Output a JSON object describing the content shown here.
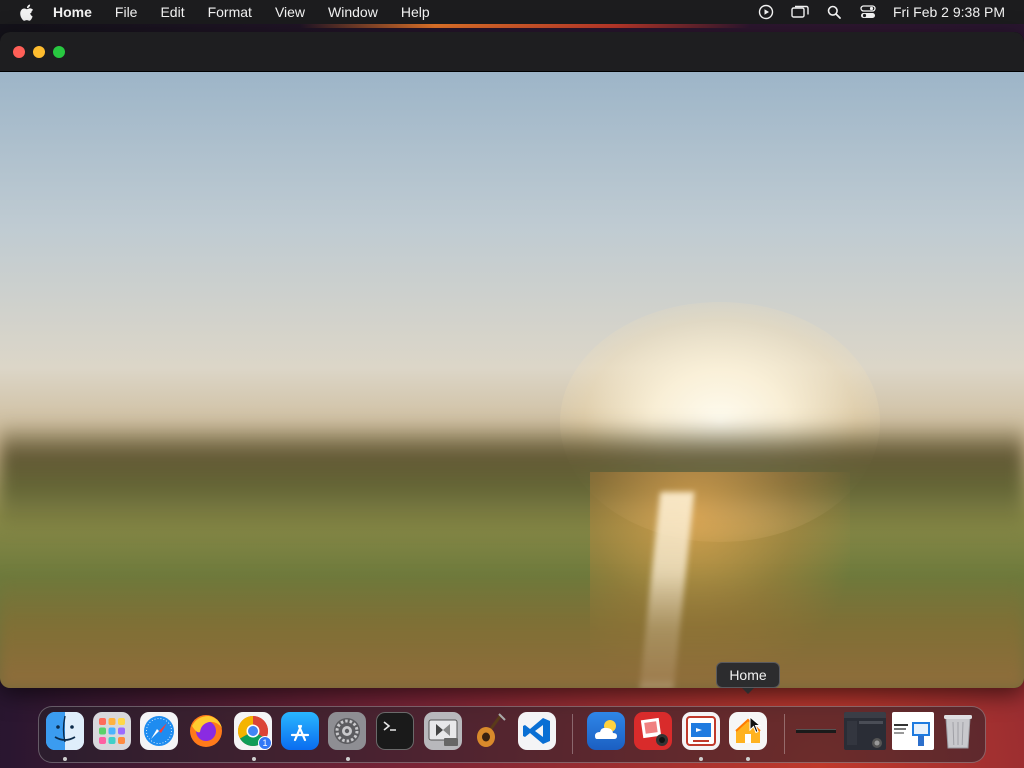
{
  "menubar": {
    "app_name": "Home",
    "items": [
      "File",
      "Edit",
      "Format",
      "View",
      "Window",
      "Help"
    ],
    "clock": "Fri Feb 2  9:38 PM",
    "status_icons": [
      "play-circle-icon",
      "screen-mirroring-icon",
      "spotlight-search-icon",
      "control-center-icon"
    ]
  },
  "window": {
    "traffic_lights": [
      "close",
      "minimize",
      "zoom"
    ]
  },
  "dock": {
    "tooltip": "Home",
    "apps": [
      {
        "name": "Finder",
        "icon": "finder-icon",
        "running": true
      },
      {
        "name": "Launchpad",
        "icon": "launchpad-icon",
        "running": false
      },
      {
        "name": "Safari",
        "icon": "safari-icon",
        "running": false
      },
      {
        "name": "Firefox",
        "icon": "firefox-icon",
        "running": false
      },
      {
        "name": "Google Chrome",
        "icon": "chrome-icon",
        "running": true,
        "badge": "1"
      },
      {
        "name": "App Store",
        "icon": "app-store-icon",
        "running": false
      },
      {
        "name": "System Settings",
        "icon": "system-settings-icon",
        "running": true
      },
      {
        "name": "Terminal",
        "icon": "terminal-icon",
        "running": false
      },
      {
        "name": "Boot Camp Assistant",
        "icon": "boot-camp-icon",
        "running": false
      },
      {
        "name": "GarageBand",
        "icon": "garageband-icon",
        "running": false
      },
      {
        "name": "Visual Studio Code",
        "icon": "vscode-icon",
        "running": false
      },
      {
        "name": "Weather",
        "icon": "weather-icon",
        "running": false
      },
      {
        "name": "Photo Booth",
        "icon": "photo-booth-icon",
        "running": false
      },
      {
        "name": "Microsoft Remote Desktop",
        "icon": "remote-desktop-icon",
        "running": true
      },
      {
        "name": "Home",
        "icon": "home-icon",
        "running": true
      },
      {
        "name": "Minimized Window 1",
        "icon": "minimized-window-icon",
        "running": false
      },
      {
        "name": "Minimized Window 2",
        "icon": "minimized-window-icon",
        "running": false
      },
      {
        "name": "Minimized Window 3",
        "icon": "minimized-window-icon",
        "running": false
      },
      {
        "name": "Trash",
        "icon": "trash-icon",
        "running": false
      }
    ]
  },
  "colors": {
    "menubar_bg": "#1c1c1e",
    "close": "#ff5f57",
    "minimize": "#febc2e",
    "zoom": "#28c840",
    "badge": "#3478f6"
  }
}
